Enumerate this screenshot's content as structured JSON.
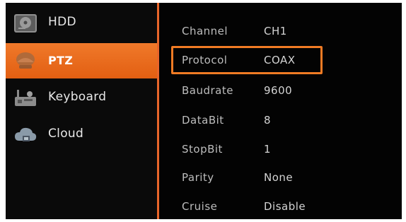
{
  "sidebar": {
    "items": [
      {
        "label": "HDD",
        "icon": "hdd-icon"
      },
      {
        "label": "PTZ",
        "icon": "ptz-camera-icon",
        "active": true
      },
      {
        "label": "Keyboard",
        "icon": "keyboard-icon"
      },
      {
        "label": "Cloud",
        "icon": "cloud-icon"
      }
    ]
  },
  "settings": [
    {
      "label": "Channel",
      "value": "CH1"
    },
    {
      "label": "Protocol",
      "value": "COAX"
    },
    {
      "label": "Baudrate",
      "value": "9600"
    },
    {
      "label": "DataBit",
      "value": "8"
    },
    {
      "label": "StopBit",
      "value": "1"
    },
    {
      "label": "Parity",
      "value": "None"
    },
    {
      "label": "Cruise",
      "value": "Disable"
    }
  ],
  "colors": {
    "accent": "#e8652a",
    "highlight_border": "#f07b24",
    "background": "#030303"
  }
}
